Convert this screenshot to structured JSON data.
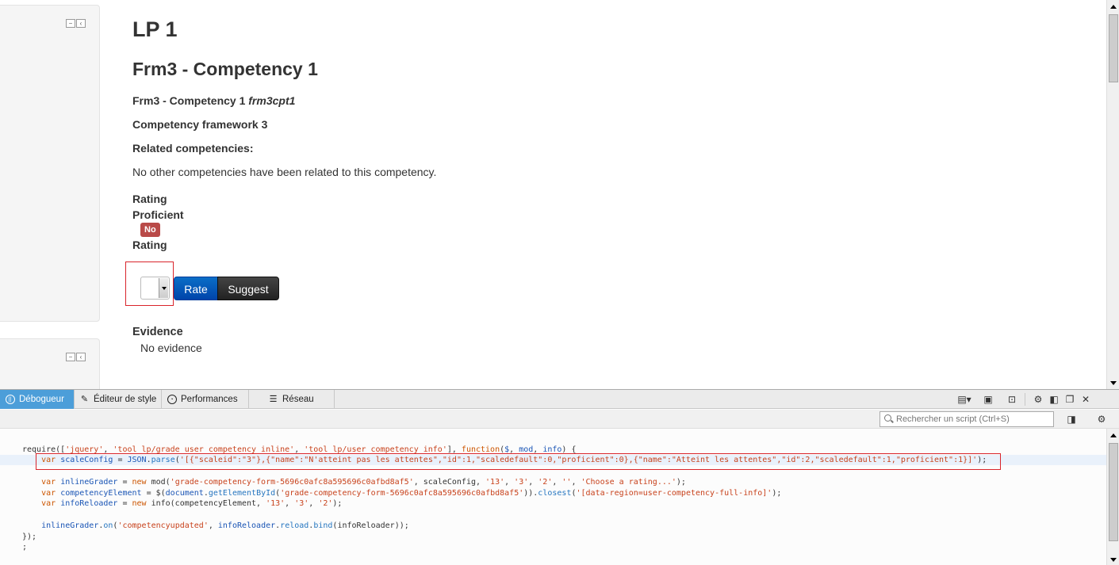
{
  "page": {
    "title": "LP 1",
    "competency_heading": "Frm3 - Competency 1",
    "competency_name": "Frm3 - Competency 1",
    "competency_idnumber": "frm3cpt1",
    "framework": "Competency framework 3",
    "related_label": "Related competencies:",
    "related_text": "No other competencies have been related to this competency.",
    "rating_label": "Rating",
    "proficient_label": "Proficient",
    "proficient_badge": "No",
    "rating_label_2": "Rating",
    "rate_button": "Rate",
    "suggest_button": "Suggest",
    "evidence_label": "Evidence",
    "evidence_text": "No evidence"
  },
  "devtools": {
    "tabs": [
      {
        "label": "Débogueur",
        "icon": "pause-icon"
      },
      {
        "label": "Éditeur de style",
        "icon": "pencil-icon"
      },
      {
        "label": "Performances",
        "icon": "gauge-icon"
      },
      {
        "label": "Réseau",
        "icon": "network-icon"
      }
    ],
    "search_placeholder": "Rechercher un script (Ctrl+S)",
    "code": {
      "l1": [
        {
          "t": "require([",
          "c": ""
        },
        {
          "t": "'jquery'",
          "c": "s"
        },
        {
          "t": ", ",
          "c": ""
        },
        {
          "t": "'tool_lp/grade_user_competency_inline'",
          "c": "s"
        },
        {
          "t": ", ",
          "c": ""
        },
        {
          "t": "'tool_lp/user_competency_info'",
          "c": "s"
        },
        {
          "t": "], ",
          "c": ""
        },
        {
          "t": "function",
          "c": "k"
        },
        {
          "t": "(",
          "c": ""
        },
        {
          "t": "$",
          "c": "v"
        },
        {
          "t": ", ",
          "c": ""
        },
        {
          "t": "mod",
          "c": "v"
        },
        {
          "t": ", ",
          "c": ""
        },
        {
          "t": "info",
          "c": "v"
        },
        {
          "t": ") {",
          "c": ""
        }
      ],
      "l2": [
        {
          "t": "    ",
          "c": ""
        },
        {
          "t": "var",
          "c": "k"
        },
        {
          "t": " ",
          "c": ""
        },
        {
          "t": "scaleConfig",
          "c": "v"
        },
        {
          "t": " = ",
          "c": ""
        },
        {
          "t": "JSON",
          "c": "v"
        },
        {
          "t": ".",
          "c": ""
        },
        {
          "t": "parse",
          "c": "p"
        },
        {
          "t": "(",
          "c": ""
        },
        {
          "t": "'[{\"scaleid\":\"3\"},{\"name\":\"N'atteint pas les attentes\",\"id\":1,\"scaledefault\":0,\"proficient\":0},{\"name\":\"Atteint les attentes\",\"id\":2,\"scaledefault\":1,\"proficient\":1}]'",
          "c": "s"
        },
        {
          "t": ");",
          "c": ""
        }
      ],
      "l3": [
        {
          "t": "    ",
          "c": ""
        },
        {
          "t": "var",
          "c": "k"
        },
        {
          "t": " ",
          "c": ""
        },
        {
          "t": "inlineGrader",
          "c": "v"
        },
        {
          "t": " = ",
          "c": ""
        },
        {
          "t": "new",
          "c": "k"
        },
        {
          "t": " mod(",
          "c": ""
        },
        {
          "t": "'grade-competency-form-5696c0afc8a595696c0afbd8af5'",
          "c": "s"
        },
        {
          "t": ", scaleConfig, ",
          "c": ""
        },
        {
          "t": "'13'",
          "c": "s"
        },
        {
          "t": ", ",
          "c": ""
        },
        {
          "t": "'3'",
          "c": "s"
        },
        {
          "t": ", ",
          "c": ""
        },
        {
          "t": "'2'",
          "c": "s"
        },
        {
          "t": ", ",
          "c": ""
        },
        {
          "t": "''",
          "c": "s"
        },
        {
          "t": ", ",
          "c": ""
        },
        {
          "t": "'Choose a rating...'",
          "c": "s"
        },
        {
          "t": ");",
          "c": ""
        }
      ],
      "l4": [
        {
          "t": "    ",
          "c": ""
        },
        {
          "t": "var",
          "c": "k"
        },
        {
          "t": " ",
          "c": ""
        },
        {
          "t": "competencyElement",
          "c": "v"
        },
        {
          "t": " = $(",
          "c": ""
        },
        {
          "t": "document",
          "c": "v"
        },
        {
          "t": ".",
          "c": ""
        },
        {
          "t": "getElementById",
          "c": "p"
        },
        {
          "t": "(",
          "c": ""
        },
        {
          "t": "'grade-competency-form-5696c0afc8a595696c0afbd8af5'",
          "c": "s"
        },
        {
          "t": ")).",
          "c": ""
        },
        {
          "t": "closest",
          "c": "p"
        },
        {
          "t": "(",
          "c": ""
        },
        {
          "t": "'[data-region=user-competency-full-info]'",
          "c": "s"
        },
        {
          "t": ");",
          "c": ""
        }
      ],
      "l5": [
        {
          "t": "    ",
          "c": ""
        },
        {
          "t": "var",
          "c": "k"
        },
        {
          "t": " ",
          "c": ""
        },
        {
          "t": "infoReloader",
          "c": "v"
        },
        {
          "t": " = ",
          "c": ""
        },
        {
          "t": "new",
          "c": "k"
        },
        {
          "t": " info(competencyElement, ",
          "c": ""
        },
        {
          "t": "'13'",
          "c": "s"
        },
        {
          "t": ", ",
          "c": ""
        },
        {
          "t": "'3'",
          "c": "s"
        },
        {
          "t": ", ",
          "c": ""
        },
        {
          "t": "'2'",
          "c": "s"
        },
        {
          "t": ");",
          "c": ""
        }
      ],
      "l6": [
        {
          "t": "    ",
          "c": ""
        },
        {
          "t": "inlineGrader",
          "c": "v"
        },
        {
          "t": ".",
          "c": ""
        },
        {
          "t": "on",
          "c": "p"
        },
        {
          "t": "(",
          "c": ""
        },
        {
          "t": "'competencyupdated'",
          "c": "s"
        },
        {
          "t": ", ",
          "c": ""
        },
        {
          "t": "infoReloader",
          "c": "v"
        },
        {
          "t": ".",
          "c": ""
        },
        {
          "t": "reload",
          "c": "p"
        },
        {
          "t": ".",
          "c": ""
        },
        {
          "t": "bind",
          "c": "p"
        },
        {
          "t": "(infoReloader));",
          "c": ""
        }
      ],
      "l7": [
        {
          "t": "});",
          "c": ""
        }
      ],
      "l8": [
        {
          "t": ";",
          "c": ""
        }
      ]
    }
  },
  "colors": {
    "badge": "#b94a48",
    "rate_button": "#0055b3",
    "suggest_button": "#333333",
    "debugger_tab_active": "#4c9ed9",
    "highlight_box": "#d9242b"
  }
}
